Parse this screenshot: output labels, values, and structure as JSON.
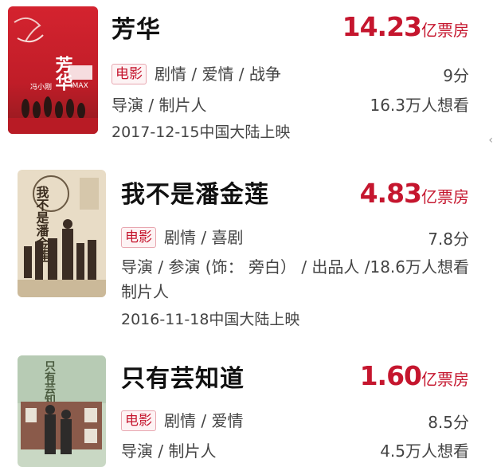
{
  "movies": [
    {
      "title": "芳华",
      "box_number": "14.23",
      "box_unit": "亿票房",
      "type_tag": "电影",
      "genres": "剧情 / 爱情 / 战争",
      "score": "9分",
      "roles": "导演 / 制片人",
      "roles_line2": "",
      "want": "16.3万人想看",
      "release": "2017-12-15中国大陆上映",
      "poster_text": "芳华",
      "poster_badge": "IMAX",
      "poster_credit": "冯小刚"
    },
    {
      "title": "我不是潘金莲",
      "box_number": "4.83",
      "box_unit": "亿票房",
      "type_tag": "电影",
      "genres": "剧情 / 喜剧",
      "score": "7.8分",
      "roles": "导演 / 参演 (饰： 旁白） / 出品人 /",
      "roles_line2": "制片人",
      "want": "18.6万人想看",
      "release": "2016-11-18中国大陆上映",
      "poster_text": "我不是潘金莲"
    },
    {
      "title": "只有芸知道",
      "box_number": "1.60",
      "box_unit": "亿票房",
      "type_tag": "电影",
      "genres": "剧情 / 爱情",
      "score": "8.5分",
      "roles": "导演 / 制片人",
      "roles_line2": "",
      "want": "4.5万人想看",
      "release": "",
      "poster_text": "只有芸知道"
    }
  ],
  "colors": {
    "accent": "#c5162e",
    "text": "#222222",
    "muted": "#444444"
  }
}
